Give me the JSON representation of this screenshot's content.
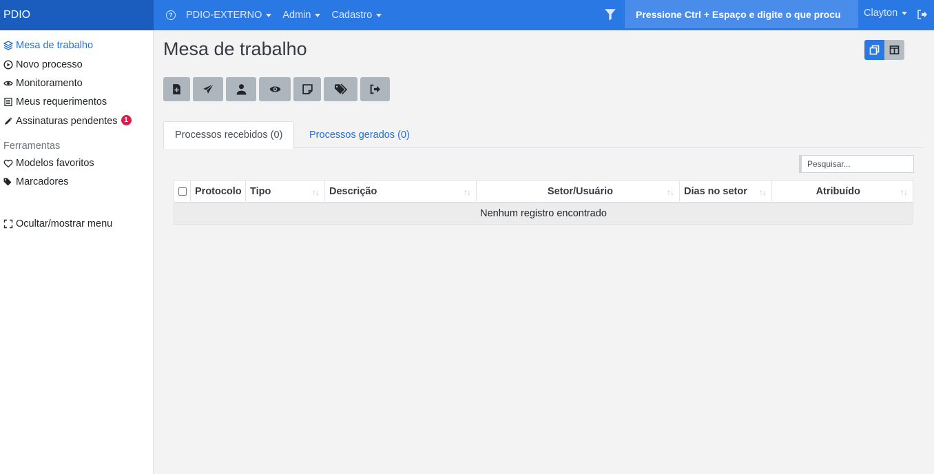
{
  "brand": {
    "title": "PDIO"
  },
  "topbar": {
    "menus": [
      {
        "label": "PDIO-EXTERNO"
      },
      {
        "label": "Admin"
      },
      {
        "label": "Cadastro"
      }
    ],
    "command_search": "Pressione Ctrl + Espaço e digite o que procu",
    "user": "Clayton"
  },
  "sidebar": {
    "items": [
      {
        "label": "Mesa de trabalho",
        "icon": "layers-icon"
      },
      {
        "label": "Novo processo",
        "icon": "play-circle-icon"
      },
      {
        "label": "Monitoramento",
        "icon": "eye-icon"
      },
      {
        "label": "Meus requerimentos",
        "icon": "document-list-icon"
      },
      {
        "label": "Assinaturas pendentes",
        "icon": "pen-icon",
        "badge": "1"
      }
    ],
    "section_header": "Ferramentas",
    "tools": [
      {
        "label": "Modelos favoritos",
        "icon": "heart-icon"
      },
      {
        "label": "Marcadores",
        "icon": "tags-icon"
      }
    ],
    "toggle_menu": "Ocultar/mostrar menu"
  },
  "main": {
    "title": "Mesa de trabalho",
    "toolbar_icons": [
      "file-plus-icon",
      "paper-plane-icon",
      "user-icon",
      "eye-icon",
      "sticky-note-icon",
      "tags-icon",
      "sign-out-icon"
    ],
    "tabs": [
      {
        "label": "Processos recebidos (0)",
        "active": true
      },
      {
        "label": "Processos gerados (0)",
        "active": false
      }
    ],
    "search_placeholder": "Pesquisar...",
    "table": {
      "columns": [
        "Protocolo",
        "Tipo",
        "Descrição",
        "Setor/Usuário",
        "Dias no setor",
        "Atribuído"
      ],
      "empty_message": "Nenhum registro encontrado"
    }
  },
  "colors": {
    "topbar": "#2a78e4",
    "brand": "#1b5cbf",
    "accent": "#1f6fd6",
    "badge": "#dc1f4a"
  }
}
